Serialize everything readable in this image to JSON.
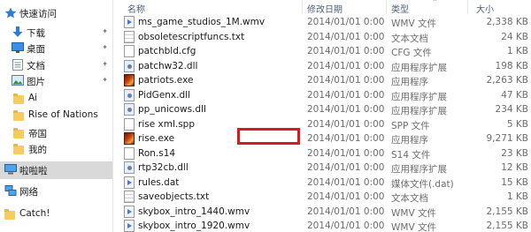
{
  "sidebar": {
    "items": [
      {
        "label": "快速访问",
        "icon": "star-icon",
        "pinned": false
      },
      {
        "label": "下载",
        "icon": "download-icon",
        "pinned": true
      },
      {
        "label": "桌面",
        "icon": "desktop-icon",
        "pinned": true
      },
      {
        "label": "文档",
        "icon": "documents-icon",
        "pinned": true
      },
      {
        "label": "图片",
        "icon": "pictures-icon",
        "pinned": true
      },
      {
        "label": "Ai",
        "icon": "folder-icon",
        "pinned": false
      },
      {
        "label": "Rise of Nations",
        "icon": "folder-icon",
        "pinned": false
      },
      {
        "label": "帝国",
        "icon": "folder-icon",
        "pinned": false
      },
      {
        "label": "我的",
        "icon": "folder-icon",
        "pinned": false
      },
      {
        "label": "啦啦啦",
        "icon": "computer-icon",
        "pinned": false
      },
      {
        "label": "网络",
        "icon": "network-icon",
        "pinned": false
      },
      {
        "label": "Catch!",
        "icon": "folder-icon",
        "pinned": false
      }
    ]
  },
  "columns": {
    "name": "名称",
    "date": "修改日期",
    "type": "类型",
    "size": "大小"
  },
  "files": [
    {
      "name": "ms_game_studios_1M.wmv",
      "date": "2014/01/01 0:00",
      "type": "WMV 文件",
      "size": "2,338 KB",
      "icon": "media-icon"
    },
    {
      "name": "obsoletescriptfuncs.txt",
      "date": "2014/01/01 0:00",
      "type": "文本文档",
      "size": "24 KB",
      "icon": "text-file-icon"
    },
    {
      "name": "patchbld.cfg",
      "date": "2014/01/01 0:00",
      "type": "CFG 文件",
      "size": "1 KB",
      "icon": "file-icon"
    },
    {
      "name": "patchw32.dll",
      "date": "2014/01/01 0:00",
      "type": "应用程序扩展",
      "size": "198 KB",
      "icon": "dll-icon"
    },
    {
      "name": "patriots.exe",
      "date": "2014/01/01 0:00",
      "type": "应用程序",
      "size": "2,263 KB",
      "icon": "exe-icon"
    },
    {
      "name": "PidGenx.dll",
      "date": "2014/01/01 0:00",
      "type": "应用程序扩展",
      "size": "47 KB",
      "icon": "dll-icon"
    },
    {
      "name": "pp_unicows.dll",
      "date": "2014/01/01 0:00",
      "type": "应用程序扩展",
      "size": "234 KB",
      "icon": "dll-icon"
    },
    {
      "name": "rise xml.spp",
      "date": "2014/01/01 0:00",
      "type": "SPP 文件",
      "size": "5 KB",
      "icon": "file-icon"
    },
    {
      "name": "rise.exe",
      "date": "2014/01/01 0:00",
      "type": "应用程序",
      "size": "9,271 KB",
      "icon": "exe-icon"
    },
    {
      "name": "Ron.s14",
      "date": "2014/01/01 0:00",
      "type": "S14 文件",
      "size": "23 KB",
      "icon": "file-icon"
    },
    {
      "name": "rtp32cb.dll",
      "date": "2014/01/01 0:00",
      "type": "应用程序扩展",
      "size": "12 KB",
      "icon": "dll-icon"
    },
    {
      "name": "rules.dat",
      "date": "2014/01/01 0:00",
      "type": "媒体文件(.dat)",
      "size": "15 KB",
      "icon": "media-icon"
    },
    {
      "name": "saveobjects.txt",
      "date": "2014/01/01 0:00",
      "type": "文本文档",
      "size": "1 KB",
      "icon": "text-file-icon"
    },
    {
      "name": "skybox_intro_1440.wmv",
      "date": "2014/01/01 0:00",
      "type": "WMV 文件",
      "size": "2,155 KB",
      "icon": "media-icon"
    },
    {
      "name": "skybox_intro_1920.wmv",
      "date": "2014/01/01 0:00",
      "type": "WMV 文件",
      "size": "2,155 KB",
      "icon": "media-icon"
    }
  ],
  "colors": {
    "highlight": "#d11d1d",
    "folder": "#f4cc60",
    "selected_nav": "#d9d9d9"
  }
}
